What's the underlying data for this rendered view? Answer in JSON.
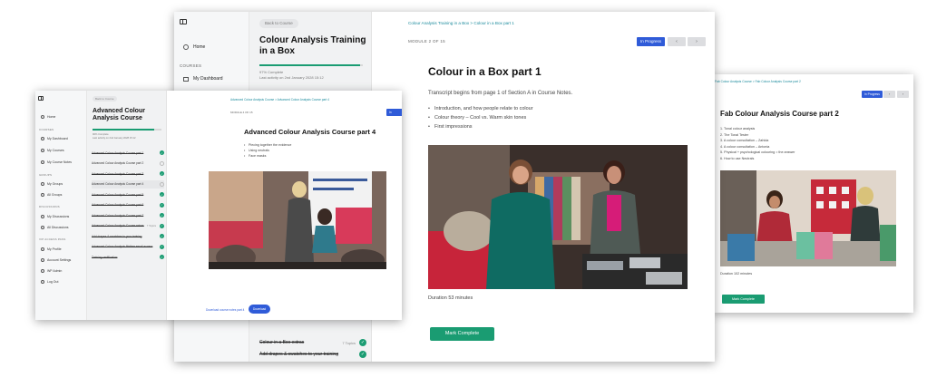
{
  "main_window": {
    "sidebar": {
      "home": "Home",
      "section_courses": "COURSES",
      "my_dashboard": "My Dashboard"
    },
    "panel": {
      "back": "Back to Course",
      "course_title": "Colour Analysis Training in a Box",
      "progress_percent": 97,
      "progress_text": "97% Complete",
      "last_activity": "Last activity on 2nd January 2028 15:12",
      "rows": [
        {
          "label": "Colour in a Box extras",
          "topics": "7 Topics"
        },
        {
          "label": "Add drapes & swatches to your training",
          "topics": ""
        }
      ]
    },
    "content": {
      "breadcrumb": "Colour Analysis Training in a Box > Colour in a Box part 1",
      "module": "MODULE 2 OF 15",
      "status": "In Progress",
      "prev": "‹",
      "next": "›",
      "lesson_title": "Colour in a Box part 1",
      "transcript": "Transcript begins from page 1 of Section A in Course Notes.",
      "bullets": [
        "Introduction, and how people relate to colour",
        "Colour theory – Cool vs. Warm skin tones",
        "First impressions"
      ],
      "duration": "Duration 53 minutes",
      "mark_complete": "Mark Complete"
    }
  },
  "left_window": {
    "sidebar": {
      "home": "Home",
      "section_courses": "COURSES",
      "my_dashboard": "My Dashboard",
      "my_courses": "My Courses",
      "my_course_notes": "My Course Notes",
      "section_groups": "GROUPS",
      "my_groups": "My Groups",
      "all_groups": "All Groups",
      "section_discussions": "DISCUSSIONS",
      "my_discussions": "My Discussions",
      "all_discussions": "All Discussions",
      "section_access": "VIP ACCESS PASS",
      "my_profile": "My Profile",
      "account_settings": "Account Settings",
      "wp_admin": "WP Admin",
      "log_out": "Log Out"
    },
    "panel": {
      "back": "Back to Course",
      "course_title": "Advanced Colour Analysis Course",
      "progress_percent": 90,
      "progress_text": "90% Complete",
      "last_activity": "Last activity on 2nd January 2028 15:12",
      "rows": [
        {
          "label": "Advanced Colour Analysis Course part 1",
          "done": true
        },
        {
          "label": "Advanced Colour Analysis Course part 2",
          "done": false
        },
        {
          "label": "Advanced Colour Analysis Course part 3",
          "done": true
        },
        {
          "label": "Advanced Colour Analysis Course part 4",
          "done": false
        },
        {
          "label": "Advanced Colour Analysis Course part 5",
          "done": true
        },
        {
          "label": "Advanced Colour Analysis Course part 6",
          "done": true
        },
        {
          "label": "Advanced Colour Analysis Course part 7",
          "done": true
        },
        {
          "label": "Advanced Colour Analysis Course extras",
          "done": true,
          "topics": "7 Topics"
        },
        {
          "label": "Add drapes & swatches to your training",
          "done": true
        },
        {
          "label": "Advanced Colour Analysis lifetime email access",
          "done": true
        },
        {
          "label": "Training certification",
          "done": true
        }
      ]
    },
    "content": {
      "breadcrumb": "Advanced Colour Analysis Course > Advanced Colour Analysis Course part 4",
      "module": "MODULE 4 OF 15",
      "status": "In Progress",
      "prev": "‹",
      "next": "›",
      "lesson_title": "Advanced Colour Analysis Course part 4",
      "bullets": [
        "Piecing together the evidence",
        "Using neutrals",
        "Face masks"
      ],
      "download_text": "Download course notes part 4",
      "download_btn": "Download"
    }
  },
  "right_window": {
    "breadcrumb": "Fab Colour Analysis Course > Fab Colour Analysis Course part 2",
    "status": "In Progress",
    "prev": "‹",
    "next": "›",
    "lesson_title": "Fab Colour Analysis Course part 2",
    "list": [
      "Tonal colour analysis",
      "The Tonal Tester",
      "A colour consultation – Zahida",
      "A colour consultation – Antonia",
      "Physical + psychological colouring = the answer",
      "How to use Neutrals"
    ],
    "duration": "Duration 102 minutes",
    "mark_complete": "Mark Complete"
  },
  "colors": {
    "accent_green": "#1a9c72",
    "accent_blue": "#2f5bd8",
    "link_teal": "#1a8a9c"
  }
}
